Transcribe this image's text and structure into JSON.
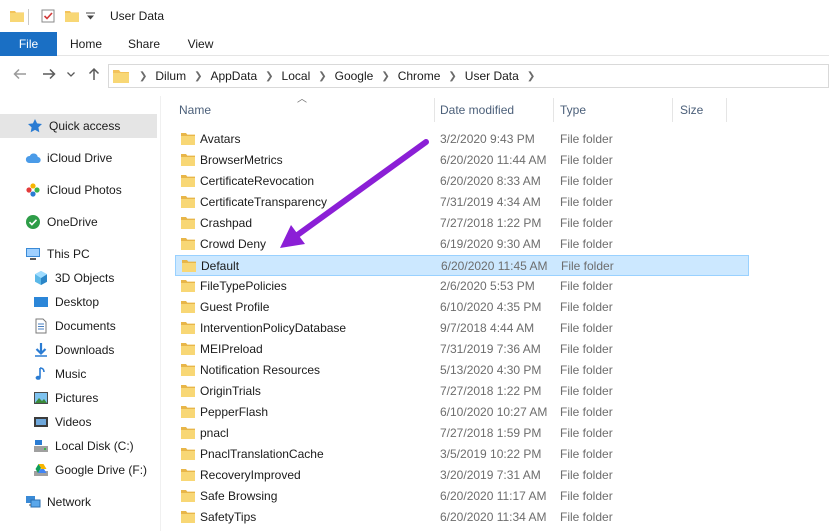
{
  "window": {
    "title": "User Data"
  },
  "ribbon": {
    "tabs": [
      "File",
      "Home",
      "Share",
      "View"
    ]
  },
  "address": {
    "crumbs": [
      "Dilum",
      "AppData",
      "Local",
      "Google",
      "Chrome",
      "User Data"
    ]
  },
  "nav": {
    "items": [
      {
        "label": "Quick access",
        "icon": "star-icon"
      },
      {
        "label": "iCloud Drive",
        "icon": "icloud-drive-icon"
      },
      {
        "label": "iCloud Photos",
        "icon": "icloud-photos-icon"
      },
      {
        "label": "OneDrive",
        "icon": "onedrive-icon"
      },
      {
        "label": "This PC",
        "icon": "this-pc-icon"
      },
      {
        "label": "3D Objects",
        "icon": "3d-objects-icon"
      },
      {
        "label": "Desktop",
        "icon": "desktop-icon"
      },
      {
        "label": "Documents",
        "icon": "documents-icon"
      },
      {
        "label": "Downloads",
        "icon": "downloads-icon"
      },
      {
        "label": "Music",
        "icon": "music-icon"
      },
      {
        "label": "Pictures",
        "icon": "pictures-icon"
      },
      {
        "label": "Videos",
        "icon": "videos-icon"
      },
      {
        "label": "Local Disk (C:)",
        "icon": "local-disk-icon"
      },
      {
        "label": "Google Drive (F:)",
        "icon": "google-drive-icon"
      },
      {
        "label": "Network",
        "icon": "network-icon"
      }
    ]
  },
  "columns": {
    "name": "Name",
    "date": "Date modified",
    "type": "Type",
    "size": "Size"
  },
  "files": [
    {
      "name": "Avatars",
      "date": "3/2/2020 9:43 PM",
      "type": "File folder"
    },
    {
      "name": "BrowserMetrics",
      "date": "6/20/2020 11:44 AM",
      "type": "File folder"
    },
    {
      "name": "CertificateRevocation",
      "date": "6/20/2020 8:33 AM",
      "type": "File folder"
    },
    {
      "name": "CertificateTransparency",
      "date": "7/31/2019 4:34 AM",
      "type": "File folder"
    },
    {
      "name": "Crashpad",
      "date": "7/27/2018 1:22 PM",
      "type": "File folder"
    },
    {
      "name": "Crowd Deny",
      "date": "6/19/2020 9:30 AM",
      "type": "File folder"
    },
    {
      "name": "Default",
      "date": "6/20/2020 11:45 AM",
      "type": "File folder"
    },
    {
      "name": "FileTypePolicies",
      "date": "2/6/2020 5:53 PM",
      "type": "File folder"
    },
    {
      "name": "Guest Profile",
      "date": "6/10/2020 4:35 PM",
      "type": "File folder"
    },
    {
      "name": "InterventionPolicyDatabase",
      "date": "9/7/2018 4:44 AM",
      "type": "File folder"
    },
    {
      "name": "MEIPreload",
      "date": "7/31/2019 7:36 AM",
      "type": "File folder"
    },
    {
      "name": "Notification Resources",
      "date": "5/13/2020 4:30 PM",
      "type": "File folder"
    },
    {
      "name": "OriginTrials",
      "date": "7/27/2018 1:22 PM",
      "type": "File folder"
    },
    {
      "name": "PepperFlash",
      "date": "6/10/2020 10:27 AM",
      "type": "File folder"
    },
    {
      "name": "pnacl",
      "date": "7/27/2018 1:59 PM",
      "type": "File folder"
    },
    {
      "name": "PnaclTranslationCache",
      "date": "3/5/2019 10:22 PM",
      "type": "File folder"
    },
    {
      "name": "RecoveryImproved",
      "date": "3/20/2019 7:31 AM",
      "type": "File folder"
    },
    {
      "name": "Safe Browsing",
      "date": "6/20/2020 11:17 AM",
      "type": "File folder"
    },
    {
      "name": "SafetyTips",
      "date": "6/20/2020 11:34 AM",
      "type": "File folder"
    }
  ],
  "selected_file": "Default",
  "colors": {
    "accent": "#1a6fc4",
    "selection": "#cce8ff",
    "annotation_arrow": "#8b1fd6",
    "folder": "#f3c35b"
  }
}
